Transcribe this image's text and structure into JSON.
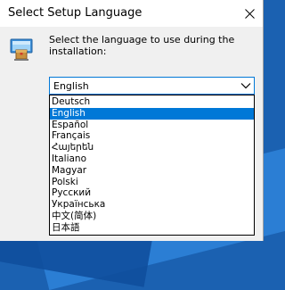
{
  "window": {
    "title": "Select Setup Language"
  },
  "prompt": {
    "text": "Select the language to use during the installation:"
  },
  "combo": {
    "selected": "English"
  },
  "dropdown": {
    "options": [
      "Deutsch",
      "English",
      "Español",
      "Français",
      "Հայերեն",
      "Italiano",
      "Magyar",
      "Polski",
      "Русский",
      "Українська",
      "中文(简体)",
      "日本語"
    ],
    "highlighted_index": 1
  },
  "colors": {
    "accent": "#0078d7",
    "dialog_bg": "#f0f0f0",
    "titlebar_bg": "#ffffff"
  },
  "icons": {
    "close": "close-icon",
    "setup": "setup-computer-icon",
    "combo_arrow": "chevron-down-icon"
  }
}
